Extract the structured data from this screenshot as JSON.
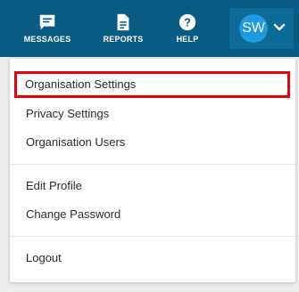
{
  "topbar": {
    "background_color": "#0a5b84",
    "nav": [
      {
        "label": "MESSAGES",
        "icon": "chat-bubble-icon"
      },
      {
        "label": "REPORTS",
        "icon": "document-icon"
      },
      {
        "label": "HELP",
        "icon": "question-icon"
      }
    ],
    "profile": {
      "initials": "SW",
      "avatar_color": "#1e9be0",
      "icon": "chevron-down-icon"
    }
  },
  "dropdown": {
    "highlight_color": "#e3040b",
    "groups": [
      {
        "items": [
          {
            "label": "Organisation Settings",
            "highlighted": true
          },
          {
            "label": "Privacy Settings"
          },
          {
            "label": "Organisation Users"
          }
        ]
      },
      {
        "items": [
          {
            "label": "Edit Profile"
          },
          {
            "label": "Change Password"
          }
        ]
      },
      {
        "items": [
          {
            "label": "Logout"
          }
        ]
      }
    ]
  }
}
